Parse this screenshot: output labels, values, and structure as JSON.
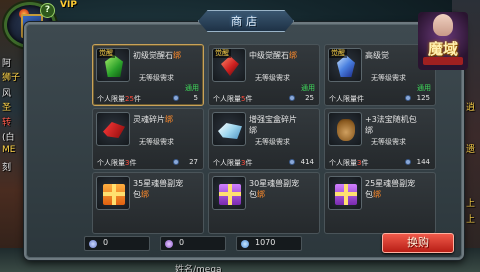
{
  "hud": {
    "vip_label": "VIP",
    "help_badge": "?",
    "left_labels": [
      "阿",
      "狮子",
      "风",
      "圣",
      "转",
      "(白",
      "ME",
      "刻"
    ],
    "right_labels": [
      "逍",
      "遗",
      "上",
      "上"
    ],
    "bottom_name": "姓名/mega",
    "logo_text": "魔域"
  },
  "shop": {
    "title": "商店",
    "close_label": "✕",
    "items": [
      {
        "name": "初级觉醒石",
        "bind": "绑",
        "binding_tag": "觉醒",
        "level": "无等级需求",
        "currency": "通用",
        "limit_label": "个人限量",
        "limit_num": "25",
        "limit_unit": "件",
        "price": "5",
        "icon": "green-gem-icon",
        "icon_class": "ic-green",
        "selected": true
      },
      {
        "name": "中级觉醒石",
        "bind": "绑",
        "binding_tag": "觉醒",
        "level": "无等级需求",
        "currency": "通用",
        "limit_label": "个人限量",
        "limit_num": "5",
        "limit_unit": "件",
        "price": "25",
        "icon": "red-gem-icon",
        "icon_class": "ic-red-gem"
      },
      {
        "name": "高级觉",
        "bind": "",
        "binding_tag": "觉醒",
        "level": "无等级需求",
        "currency": "通用",
        "limit_label": "个人限量",
        "limit_num": "",
        "limit_unit": "件",
        "price": "125",
        "icon": "blue-gem-icon",
        "icon_class": "ic-blue-gem"
      },
      {
        "name": "灵魂碎片",
        "bind": "绑",
        "binding_tag": "",
        "level": "无等级需求",
        "currency": "",
        "limit_label": "个人限量",
        "limit_num": "3",
        "limit_unit": "件",
        "price": "27",
        "icon": "red-shard-icon",
        "icon_class": "ic-red-shard"
      },
      {
        "name": "增强宝盒碎片",
        "name2": "绑",
        "bind": "",
        "binding_tag": "",
        "level": "无等级需求",
        "currency": "",
        "limit_label": "个人限量",
        "limit_num": "3",
        "limit_unit": "件",
        "price": "414",
        "icon": "crystal-icon",
        "icon_class": "ic-crystal"
      },
      {
        "name": "+3法宝随机包",
        "name2": "绑",
        "bind": "",
        "binding_tag": "",
        "level": "无等级需求",
        "currency": "",
        "limit_label": "个人限量",
        "limit_num": "3",
        "limit_unit": "件",
        "price": "144",
        "icon": "treasure-bag-icon",
        "icon_class": "ic-bag"
      },
      {
        "name": "35星魂兽副宠",
        "name2": "包",
        "bind": "绑",
        "binding_tag": "",
        "level": "",
        "currency": "",
        "limit_label": "",
        "limit_num": "",
        "limit_unit": "",
        "price": "",
        "icon": "orange-gift-icon",
        "icon_class": "ic-gift-orange"
      },
      {
        "name": "30星魂兽副宠",
        "name2": "包",
        "bind": "绑",
        "binding_tag": "",
        "level": "",
        "currency": "",
        "limit_label": "",
        "limit_num": "",
        "limit_unit": "",
        "price": "",
        "icon": "purple-gift-icon",
        "icon_class": "ic-gift-purple"
      },
      {
        "name": "25星魂兽副宠",
        "name2": "包",
        "bind": "绑",
        "binding_tag": "",
        "level": "",
        "currency": "",
        "limit_label": "",
        "limit_num": "",
        "limit_unit": "",
        "price": "",
        "icon": "purple-gift-icon",
        "icon_class": "ic-gift-purple"
      }
    ],
    "currencies": [
      {
        "value": "0",
        "icon": "awakening-coin-icon"
      },
      {
        "value": "0",
        "icon": "soul-coin-icon"
      },
      {
        "value": "1070",
        "icon": "crystal-coin-icon"
      }
    ],
    "exchange_label": "换购"
  },
  "colors": {
    "currency_green": "#3ed95a",
    "limit_red": "#ff4a3a",
    "bind_orange": "#ff8a2a",
    "exchange_red": "#d8342a"
  }
}
